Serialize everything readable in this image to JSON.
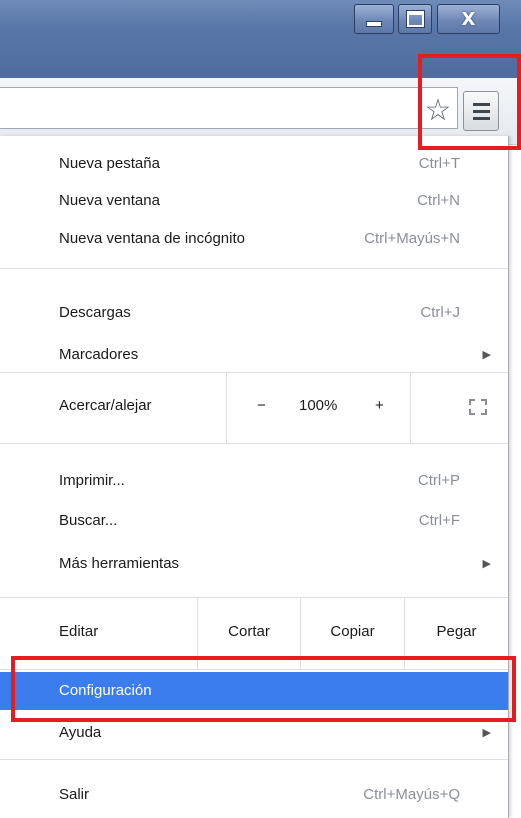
{
  "window": {
    "controls": {
      "minimize_icon": "minimize-icon",
      "maximize_icon": "maximize-icon",
      "close_glyph": "X"
    }
  },
  "toolbar": {
    "star_glyph": "☆",
    "menu_icon": "hamburger-menu-icon"
  },
  "menu": {
    "new_tab": {
      "label": "Nueva pestaña",
      "shortcut": "Ctrl+T"
    },
    "new_window": {
      "label": "Nueva ventana",
      "shortcut": "Ctrl+N"
    },
    "incognito": {
      "label": "Nueva ventana de incógnito",
      "shortcut": "Ctrl+Mayús+N"
    },
    "downloads": {
      "label": "Descargas",
      "shortcut": "Ctrl+J"
    },
    "bookmarks": {
      "label": "Marcadores",
      "arrow": "▶"
    },
    "zoom": {
      "label": "Acercar/alejar",
      "minus": "−",
      "value": "100%",
      "plus": "+"
    },
    "print": {
      "label": "Imprimir...",
      "shortcut": "Ctrl+P"
    },
    "find": {
      "label": "Buscar...",
      "shortcut": "Ctrl+F"
    },
    "more_tools": {
      "label": "Más herramientas",
      "arrow": "▶"
    },
    "edit": {
      "label": "Editar",
      "cut": "Cortar",
      "copy": "Copiar",
      "paste": "Pegar"
    },
    "settings": {
      "label": "Configuración"
    },
    "help": {
      "label": "Ayuda",
      "arrow": "▶"
    },
    "exit": {
      "label": "Salir",
      "shortcut": "Ctrl+Mayús+Q"
    }
  },
  "colors": {
    "highlight": "#e51d23",
    "selected": "#3b7ded",
    "titlebar": "#5877a8"
  }
}
